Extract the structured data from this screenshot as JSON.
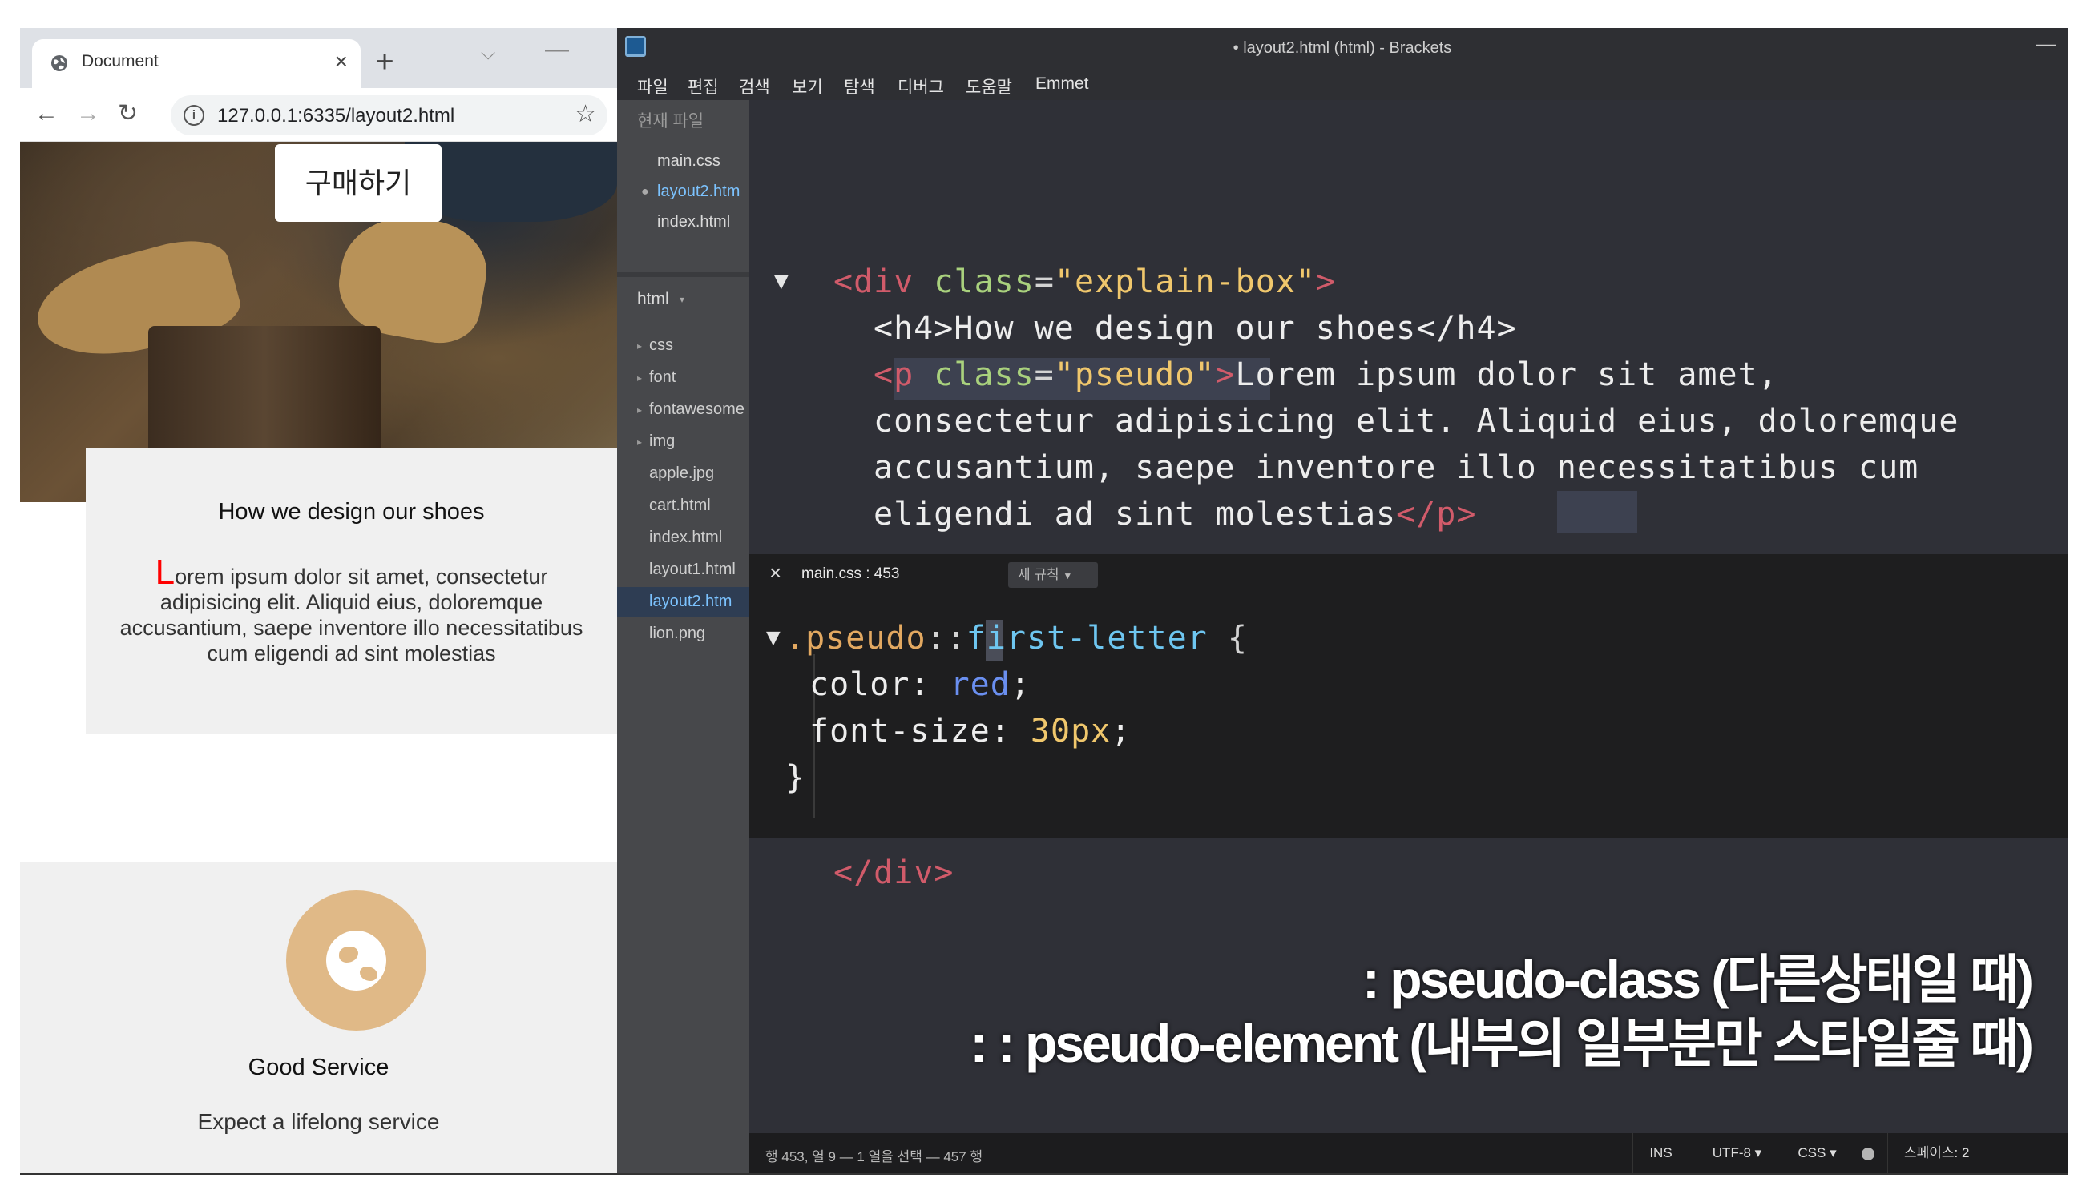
{
  "browser": {
    "tab_title": "Document",
    "tab_close": "×",
    "new_tab": "+",
    "tab_menu": "⌵",
    "win_min": "—",
    "back": "←",
    "forward": "→",
    "reload": "↻",
    "info": "i",
    "url": "127.0.0.1:6335/layout2.html",
    "star": "☆"
  },
  "page": {
    "buy_button": "구매하기",
    "explain_title": "How we design our shoes",
    "explain_first_letter": "L",
    "explain_text": "orem ipsum dolor sit amet, consectetur adipisicing elit. Aliquid eius, doloremque accusantium, saepe inventore illo necessitatibus cum eligendi ad sint molestias",
    "service_title": "Good Service",
    "service_text": "Expect a lifelong service"
  },
  "editor": {
    "window_title": "• layout2.html (html) - Brackets",
    "minimize": "—",
    "menu": [
      "파일",
      "편집",
      "검색",
      "보기",
      "탐색",
      "디버그",
      "도움말",
      "Emmet"
    ],
    "working_files_header": "현재 파일",
    "working_files": [
      "main.css",
      "layout2.htm",
      "index.html"
    ],
    "project_name": "html",
    "tree": [
      "css",
      "font",
      "fontawesome",
      "img",
      "apple.jpg",
      "cart.html",
      "index.html",
      "layout1.html",
      "layout2.htm",
      "lion.png"
    ],
    "code": {
      "line1_open": "<div class=\"explain-box\">",
      "line2": "<h4>How we design our shoes</h4>",
      "line3_tag": "<p class=\"pseudo\">",
      "line3_text": "Lorem ipsum dolor sit amet,",
      "line4": "consectetur adipisicing elit. Aliquid eius, doloremque",
      "line5": "accusantium, saepe inventore illo necessitatibus cum",
      "line6_text": "eligendi ad sint molestias",
      "line6_close": "</p>",
      "line7_close": "</div>"
    },
    "inline_editor": {
      "close": "×",
      "file_ref": "main.css : 453",
      "new_rule": "새 규칙",
      "selector_class": ".pseudo",
      "selector_colon": ":",
      "selector_colon2": ":",
      "selector_pseudo": "first-letter",
      "brace_open": "{",
      "prop1": "color",
      "val1": "red",
      "prop2": "font-size",
      "val2": "30px",
      "brace_close": "}"
    },
    "caption_line1": ": pseudo-class (다른상태일 때)",
    "caption_line2": ": : pseudo-element (내부의 일부분만 스타일줄 때)",
    "status": {
      "position": "행 453, 열 9 — 1 열을 선택 — 457 행",
      "ins": "INS",
      "encoding": "UTF-8 ▾",
      "language": "CSS ▾",
      "spaces": "스페이스: 2"
    }
  },
  "colors": {
    "first_letter": "#ff0000",
    "icon_circle": "#e0b987",
    "editor_bg": "#2f3037"
  }
}
